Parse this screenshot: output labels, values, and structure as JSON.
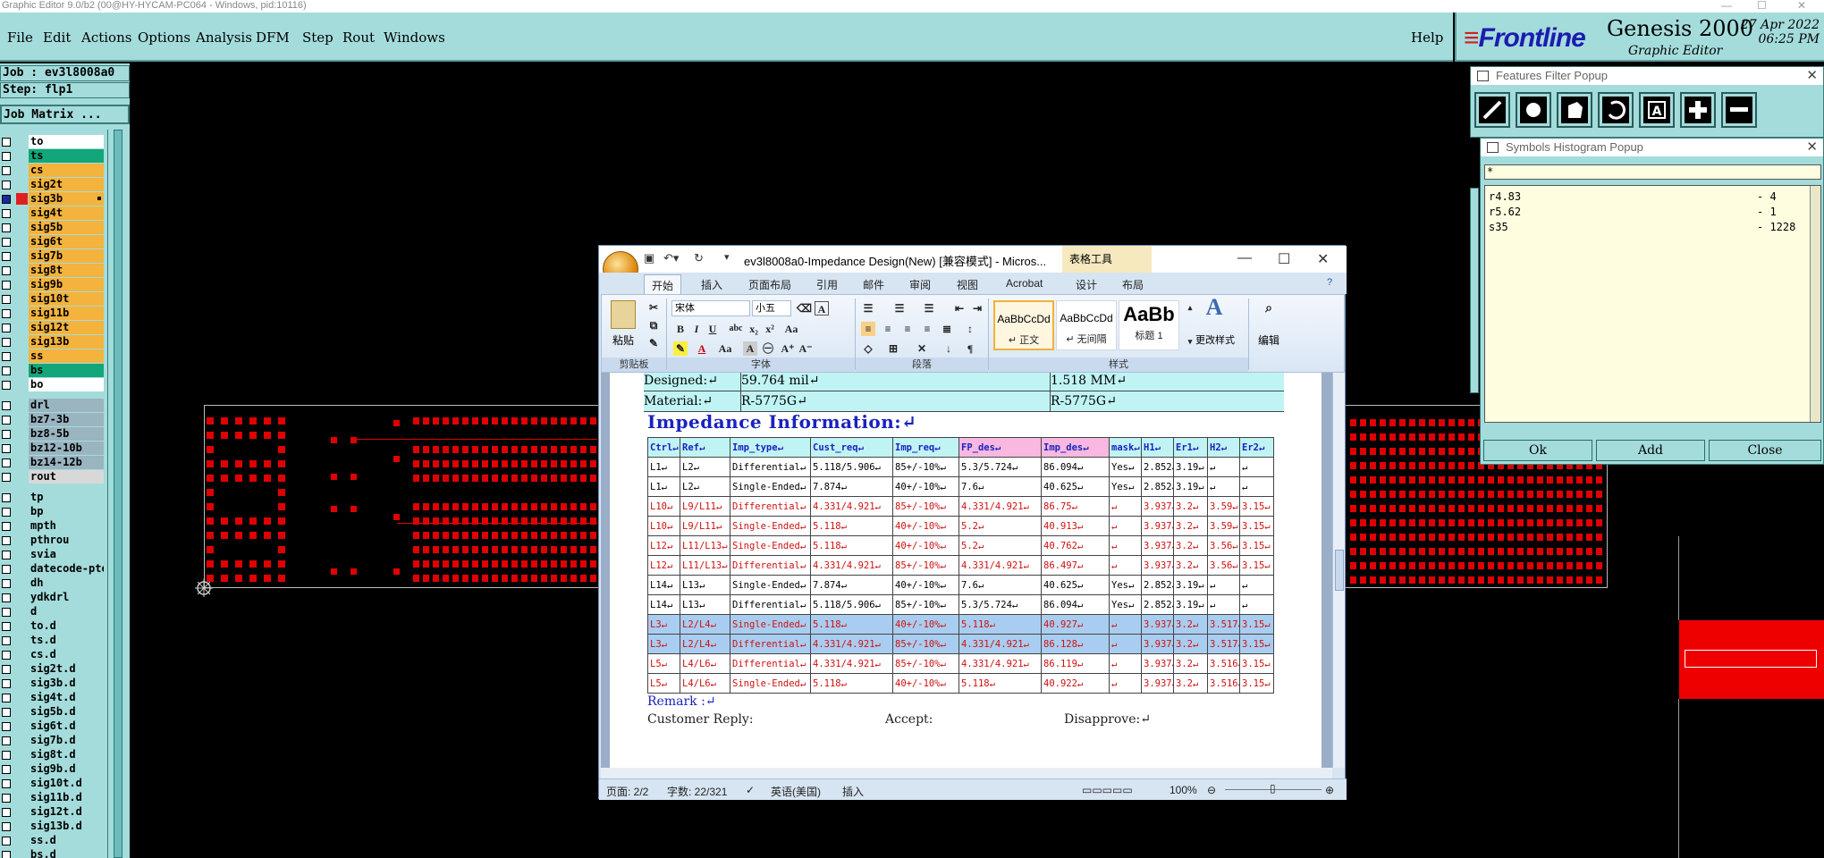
{
  "window": {
    "title": "Graphic Editor 9.0/b2 (00@HY-HYCAM-PC064 - Windows, pid:10116)"
  },
  "menu": [
    "File",
    "Edit",
    "Actions",
    "Options",
    "Analysis",
    "DFM",
    "Step",
    "Rout",
    "Windows"
  ],
  "help": "Help",
  "brand": {
    "logo": "Frontline",
    "product": "Genesis 2000",
    "sub": "Graphic Editor",
    "date": "27 Apr 2022",
    "time": "06:25 PM"
  },
  "job": "Job : ev3l8008a0",
  "step": "Step: flp1",
  "job_matrix": "Job Matrix ...",
  "layers": [
    {
      "name": "to",
      "color": "#ffffff"
    },
    {
      "name": "ts",
      "color": "#12a67a"
    },
    {
      "name": "cs",
      "color": "#f4b33c"
    },
    {
      "name": "sig2t",
      "color": "#f4b33c"
    },
    {
      "name": "sig3b",
      "color": "#f4b33c",
      "active": true
    },
    {
      "name": "sig4t",
      "color": "#f4b33c"
    },
    {
      "name": "sig5b",
      "color": "#f4b33c"
    },
    {
      "name": "sig6t",
      "color": "#f4b33c"
    },
    {
      "name": "sig7b",
      "color": "#f4b33c"
    },
    {
      "name": "sig8t",
      "color": "#f4b33c"
    },
    {
      "name": "sig9b",
      "color": "#f4b33c"
    },
    {
      "name": "sig10t",
      "color": "#f4b33c"
    },
    {
      "name": "sig11b",
      "color": "#f4b33c"
    },
    {
      "name": "sig12t",
      "color": "#f4b33c"
    },
    {
      "name": "sig13b",
      "color": "#f4b33c"
    },
    {
      "name": "ss",
      "color": "#f4b33c"
    },
    {
      "name": "bs",
      "color": "#12a67a"
    },
    {
      "name": "bo",
      "color": "#ffffff"
    },
    {
      "name": "drl",
      "color": "#9ab4c0",
      "gap": true
    },
    {
      "name": "bz7-3b",
      "color": "#9ab4c0"
    },
    {
      "name": "bz8-5b",
      "color": "#9ab4c0"
    },
    {
      "name": "bz12-10b",
      "color": "#9ab4c0"
    },
    {
      "name": "bz14-12b",
      "color": "#9ab4c0"
    },
    {
      "name": "rout",
      "color": "#d8d8d8"
    },
    {
      "name": "tp",
      "color": "#a4dcdc",
      "gap": true
    },
    {
      "name": "bp",
      "color": "#a4dcdc"
    },
    {
      "name": "mpth",
      "color": "#a4dcdc"
    },
    {
      "name": "pthrou",
      "color": "#a4dcdc"
    },
    {
      "name": "svia",
      "color": "#a4dcdc"
    },
    {
      "name": "datecode-pte",
      "color": "#a4dcdc"
    },
    {
      "name": "dh",
      "color": "#a4dcdc"
    },
    {
      "name": "ydkdrl",
      "color": "#a4dcdc"
    },
    {
      "name": "d",
      "color": "#a4dcdc"
    },
    {
      "name": "to.d",
      "color": "#a4dcdc"
    },
    {
      "name": "ts.d",
      "color": "#a4dcdc"
    },
    {
      "name": "cs.d",
      "color": "#a4dcdc"
    },
    {
      "name": "sig2t.d",
      "color": "#a4dcdc"
    },
    {
      "name": "sig3b.d",
      "color": "#a4dcdc"
    },
    {
      "name": "sig4t.d",
      "color": "#a4dcdc"
    },
    {
      "name": "sig5b.d",
      "color": "#a4dcdc"
    },
    {
      "name": "sig6t.d",
      "color": "#a4dcdc"
    },
    {
      "name": "sig7b.d",
      "color": "#a4dcdc"
    },
    {
      "name": "sig8t.d",
      "color": "#a4dcdc"
    },
    {
      "name": "sig9b.d",
      "color": "#a4dcdc"
    },
    {
      "name": "sig10t.d",
      "color": "#a4dcdc"
    },
    {
      "name": "sig11b.d",
      "color": "#a4dcdc"
    },
    {
      "name": "sig12t.d",
      "color": "#a4dcdc"
    },
    {
      "name": "sig13b.d",
      "color": "#a4dcdc"
    },
    {
      "name": "ss.d",
      "color": "#a4dcdc"
    },
    {
      "name": "bs.d",
      "color": "#a4dcdc"
    }
  ],
  "features_popup": {
    "title": "Features Filter Popup",
    "tools": [
      "line-icon",
      "pad-icon",
      "surface-icon",
      "arc-icon",
      "text-icon",
      "plus-icon",
      "minus-icon"
    ]
  },
  "histogram_popup": {
    "title": "Symbols Histogram Popup",
    "filter": "*",
    "rows": [
      {
        "sym": "r4.83",
        "count": "- 4"
      },
      {
        "sym": "r5.62",
        "count": "- 1"
      },
      {
        "sym": "s35",
        "count": "- 1228"
      }
    ],
    "ok": "Ok",
    "add": "Add",
    "close": "Close"
  },
  "word": {
    "title": "ev3l8008a0-Impedance Design(New) [兼容模式] - Micros...",
    "context_tab": "表格工具",
    "tabs": [
      "开始",
      "插入",
      "页面布局",
      "引用",
      "邮件",
      "审阅",
      "视图",
      "Acrobat",
      "设计",
      "布局"
    ],
    "groups": {
      "clipboard": "剪贴板",
      "font": "字体",
      "paragraph": "段落",
      "styles": "样式"
    },
    "paste": "粘贴",
    "font_name": "宋体",
    "font_size": "小五",
    "styles": [
      {
        "preview": "AaBbCcDd",
        "name": "↵ 正文"
      },
      {
        "preview": "AaBbCcDd",
        "name": "↵ 无间隔"
      },
      {
        "preview": "AaBb",
        "name": "标题 1"
      }
    ],
    "change_styles": "更改样式",
    "edit": "编辑",
    "designed_label": "Designed:↵",
    "designed_val": "59.764 mil↵",
    "designed_mm": "1.518 MM↵",
    "material_label": "Material:↵",
    "material_val": "R-5775G↵",
    "material_val2": "R-5775G↵",
    "impedance_heading": "Impedance Information:↵",
    "table_headers": [
      "Ctrl↵",
      "Ref↵",
      "Imp_type↵",
      "Cust_req↵",
      "Imp_req↵",
      "FP_des↵",
      "Imp_des↵",
      "mask↵",
      "H1↵",
      "Er1↵",
      "H2↵",
      "Er2↵"
    ],
    "table_rows": [
      {
        "cells": [
          "L1↵",
          "L2↵",
          "Differential↵",
          "5.118/5.906↵",
          "85+/-10%↵",
          "5.3/5.724↵",
          "86.094↵",
          "Yes↵",
          "2.852↵",
          "3.19↵",
          "↵",
          "↵"
        ],
        "style": "normal"
      },
      {
        "cells": [
          "L1↵",
          "L2↵",
          "Single-Ended↵",
          "7.874↵",
          "40+/-10%↵",
          "7.6↵",
          "40.625↵",
          "Yes↵",
          "2.852↵",
          "3.19↵",
          "↵",
          "↵"
        ],
        "style": "normal"
      },
      {
        "cells": [
          "L10↵",
          "L9/L11↵",
          "Differential↵",
          "4.331/4.921↵",
          "85+/-10%↵",
          "4.331/4.921↵",
          "86.75↵",
          "↵",
          "3.937↵",
          "3.2↵",
          "3.59↵",
          "3.15↵"
        ],
        "style": "red"
      },
      {
        "cells": [
          "L10↵",
          "L9/L11↵",
          "Single-Ended↵",
          "5.118↵",
          "40+/-10%↵",
          "5.2↵",
          "40.913↵",
          "↵",
          "3.937↵",
          "3.2↵",
          "3.59↵",
          "3.15↵"
        ],
        "style": "red"
      },
      {
        "cells": [
          "L12↵",
          "L11/L13↵",
          "Single-Ended↵",
          "5.118↵",
          "40+/-10%↵",
          "5.2↵",
          "40.762↵",
          "↵",
          "3.937↵",
          "3.2↵",
          "3.56↵",
          "3.15↵"
        ],
        "style": "red"
      },
      {
        "cells": [
          "L12↵",
          "L11/L13↵",
          "Differential↵",
          "4.331/4.921↵",
          "85+/-10%↵",
          "4.331/4.921↵",
          "86.497↵",
          "↵",
          "3.937↵",
          "3.2↵",
          "3.56↵",
          "3.15↵"
        ],
        "style": "red"
      },
      {
        "cells": [
          "L14↵",
          "L13↵",
          "Single-Ended↵",
          "7.874↵",
          "40+/-10%↵",
          "7.6↵",
          "40.625↵",
          "Yes↵",
          "2.852↵",
          "3.19↵",
          "↵",
          "↵"
        ],
        "style": "normal"
      },
      {
        "cells": [
          "L14↵",
          "L13↵",
          "Differential↵",
          "5.118/5.906↵",
          "85+/-10%↵",
          "5.3/5.724↵",
          "86.094↵",
          "Yes↵",
          "2.852↵",
          "3.19↵",
          "↵",
          "↵"
        ],
        "style": "normal"
      },
      {
        "cells": [
          "L3↵",
          "L2/L4↵",
          "Single-Ended↵",
          "5.118↵",
          "40+/-10%↵",
          "5.118↵",
          "40.927↵",
          "↵",
          "3.937↵",
          "3.2↵",
          "3.517↵",
          "3.15↵"
        ],
        "style": "sel"
      },
      {
        "cells": [
          "L3↵",
          "L2/L4↵",
          "Differential↵",
          "4.331/4.921↵",
          "85+/-10%↵",
          "4.331/4.921↵",
          "86.128↵",
          "↵",
          "3.937↵",
          "3.2↵",
          "3.517↵",
          "3.15↵"
        ],
        "style": "sel"
      },
      {
        "cells": [
          "L5↵",
          "L4/L6↵",
          "Differential↵",
          "4.331/4.921↵",
          "85+/-10%↵",
          "4.331/4.921↵",
          "86.119↵",
          "↵",
          "3.937↵",
          "3.2↵",
          "3.516↵",
          "3.15↵"
        ],
        "style": "red"
      },
      {
        "cells": [
          "L5↵",
          "L4/L6↵",
          "Single-Ended↵",
          "5.118↵",
          "40+/-10%↵",
          "5.118↵",
          "40.922↵",
          "↵",
          "3.937↵",
          "3.2↵",
          "3.516↵",
          "3.15↵"
        ],
        "style": "red"
      }
    ],
    "remark": "Remark :↵",
    "customer_reply": "Customer Reply:",
    "accept": "Accept:",
    "disapprove": "Disapprove:↵",
    "status": {
      "page": "页面: 2/2",
      "words": "字数: 22/321",
      "lang": "英语(美国)",
      "mode": "插入",
      "zoom": "100%"
    }
  }
}
